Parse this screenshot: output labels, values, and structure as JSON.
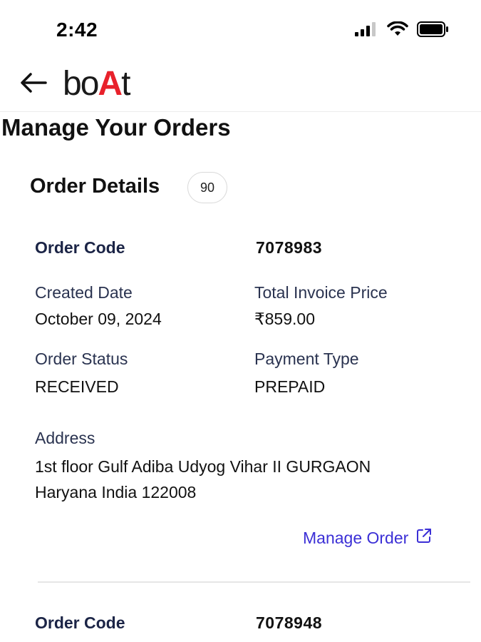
{
  "status_bar": {
    "time": "2:42",
    "icons": [
      "cellular-signal-icon",
      "wifi-icon",
      "battery-icon"
    ]
  },
  "header": {
    "back_icon": "arrow-left-icon",
    "brand": {
      "part1": "bo",
      "accent": "A",
      "part2": "t",
      "accent_color": "#e8212b"
    }
  },
  "page_title": "Manage Your Orders",
  "order_details": {
    "title": "Order Details",
    "count": "90"
  },
  "orders": [
    {
      "code_label": "Order Code",
      "code": "7078983",
      "created_date_label": "Created Date",
      "created_date": "October 09, 2024",
      "total_label": "Total Invoice Price",
      "total": "₹859.00",
      "status_label": "Order Status",
      "status": "RECEIVED",
      "payment_label": "Payment Type",
      "payment": "PREPAID",
      "address_label": "Address",
      "address": "1st floor Gulf Adiba Udyog Vihar II GURGAON Haryana India 122008",
      "manage_label": "Manage Order",
      "manage_icon": "external-link-icon"
    },
    {
      "code_label": "Order Code",
      "code": "7078948"
    }
  ],
  "colors": {
    "link": "#3b2fd6",
    "label_strong": "#1b2446",
    "divider": "#e6e6e6"
  }
}
